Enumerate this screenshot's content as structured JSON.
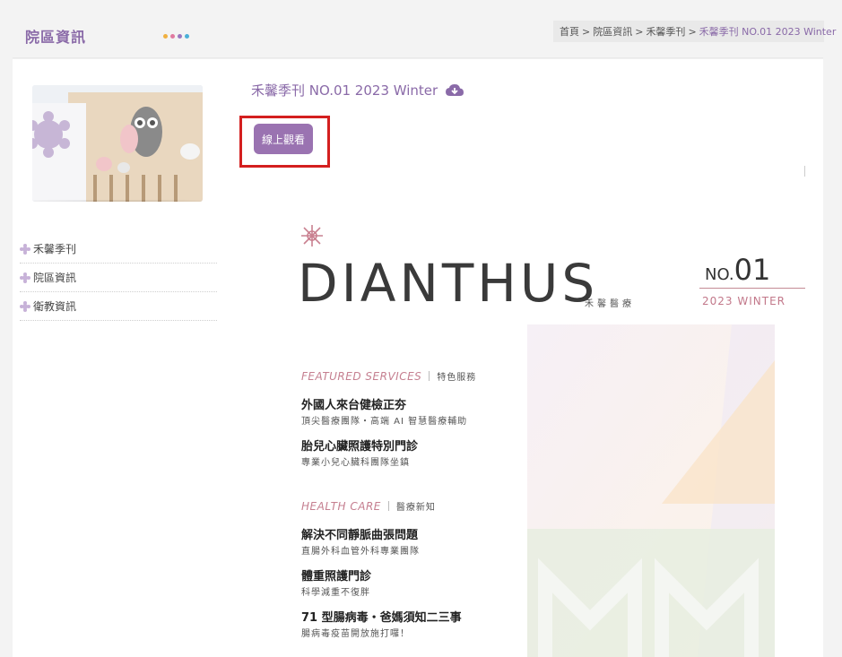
{
  "section": {
    "title": "院區資訊"
  },
  "breadcrumb": {
    "items": [
      "首頁",
      "院區資訊",
      "禾馨季刊"
    ],
    "separator": ">",
    "current": "禾馨季刊 NO.01 2023 Winter"
  },
  "sidebar": {
    "items": [
      {
        "label": "禾馨季刊"
      },
      {
        "label": "院區資訊"
      },
      {
        "label": "衛教資訊"
      }
    ]
  },
  "publication": {
    "title": "禾馨季刊 NO.01 2023 Winter",
    "download_icon": "cloud-download-icon",
    "watch_button_label": "線上觀看"
  },
  "cover": {
    "brand": "DIANTHUS",
    "brand_cn": "禾馨醫療",
    "issue_prefix": "NO.",
    "issue_number": "01",
    "season": "2023 WINTER",
    "sections": [
      {
        "heading_en": "FEATURED SERVICES",
        "heading_cn": "特色服務",
        "articles": [
          {
            "title": "外國人來台健檢正夯",
            "subtitle": "頂尖醫療團隊・高端 AI 智慧醫療輔助"
          },
          {
            "title": "胎兒心臟照護特別門診",
            "subtitle": "專業小兒心臟科團隊坐鎮"
          }
        ]
      },
      {
        "heading_en": "HEALTH CARE",
        "heading_cn": "醫療新知",
        "articles": [
          {
            "title": "解決不同靜脈曲張問題",
            "subtitle": "直腸外科血管外科專業團隊"
          },
          {
            "title": "體重照護門診",
            "subtitle": "科學減重不復胖"
          },
          {
            "title": "71 型腸病毒・爸媽須知二三事",
            "subtitle": "腸病毒疫苗開放施打囉！"
          }
        ]
      }
    ]
  },
  "colors": {
    "accent": "#8a6aa8",
    "button": "#9a73b1",
    "highlight": "#d41f1f",
    "cover_accent": "#c57f90"
  }
}
